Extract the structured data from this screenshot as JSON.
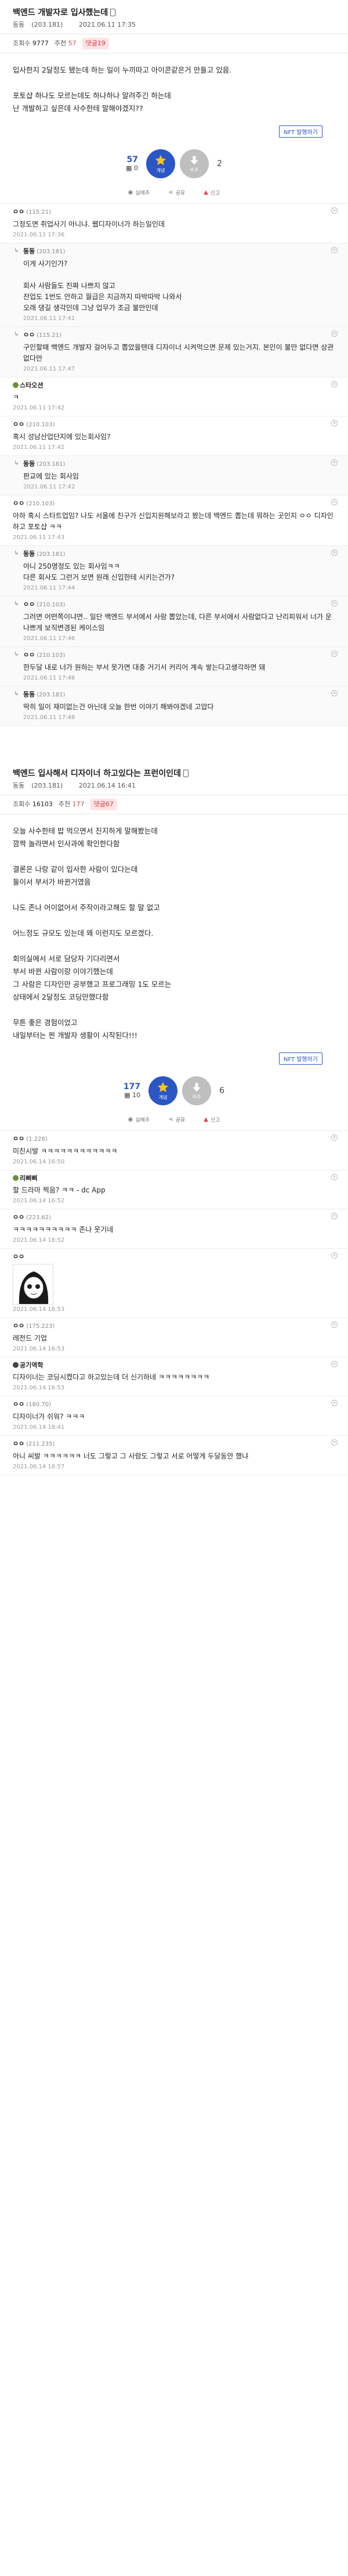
{
  "posts": [
    {
      "title": "백엔드 개발자로 입사했는데",
      "author": "동동",
      "author_ip": "(203.181)",
      "date": "2021.06.11 17:35",
      "views_label": "조회수",
      "views": "9777",
      "recommend_label": "추천",
      "recommend": "57",
      "comments_label": "댓글",
      "comments": "19",
      "body": [
        "입사한지 2달정도 됐는데 하는 일이 누끼따고 아이콘같은거 만들고 있음.",
        "",
        "포토샵 하나도 모르는데도 하나하나 알려주긴 하는데",
        "난 개발하고 싶은데 사수한테 말해야겠지??"
      ],
      "nft_label": "NFT 발행하기",
      "vote_up": "57",
      "vote_fix": "0",
      "vote_up_label": "개념",
      "vote_down_label": "비추",
      "vote_down": "2",
      "actions": [
        "실베추",
        "공유",
        "신고"
      ],
      "comments_list": [
        {
          "reply": false,
          "nick": "ㅇㅇ",
          "ip": "(115.21)",
          "icon": "",
          "text": "그정도면 취업사기 아니냐. 웹디자이너가 하는일인데",
          "date": "2021.06.11 17:36"
        },
        {
          "reply": true,
          "nick": "동동",
          "ip": "(203.181)",
          "icon": "",
          "text": "이게 사기인가?\n\n회사 사람들도 진짜 나쁘지 않고\n잔업도 1번도 안하고 월급은 지금까지 따박따박 나와서\n오래 댕길 생각인데 그냥 업무가 조금 불만인데",
          "date": "2021.06.11 17:41"
        },
        {
          "reply": true,
          "nick": "ㅇㅇ",
          "ip": "(115.21)",
          "icon": "",
          "text": "구인할때 백엔드 개발자 걸어두고 뽑았을텐데 디자이너 시켜먹으면 문제 있는거지. 본인이 불만 없다면 상관없다만",
          "date": "2021.06.11 17:47"
        },
        {
          "reply": false,
          "nick": "스타오션",
          "ip": "",
          "icon": "g",
          "text": "ㅋ",
          "date": "2021.06.11 17:42"
        },
        {
          "reply": false,
          "nick": "ㅇㅇ",
          "ip": "(210.103)",
          "icon": "",
          "text": "혹시 성남산업단지에 있는회사임?",
          "date": "2021.06.11 17:42"
        },
        {
          "reply": true,
          "nick": "동동",
          "ip": "(203.181)",
          "icon": "",
          "text": "판교에 있는 회사임",
          "date": "2021.06.11 17:42"
        },
        {
          "reply": false,
          "nick": "ㅇㅇ",
          "ip": "(210.103)",
          "icon": "",
          "text": "아하 혹시 스타트업임? 나도 서울에 친구가 신입지원해보라고 봤는데 백엔드 뽑는데 뭐하는 곳인지 ㅇㅇ 디자인하고 포토샵 ㅋㅋ",
          "date": "2021.06.11 17:43"
        },
        {
          "reply": true,
          "nick": "동동",
          "ip": "(203.181)",
          "icon": "",
          "text": "아니 250명정도 있는 회사임ㅋㅋ\n다른 회사도 그런거 보면 원래 신입한테 시키는건가?",
          "date": "2021.06.11 17:44"
        },
        {
          "reply": true,
          "nick": "ㅇㅇ",
          "ip": "(210.103)",
          "icon": "",
          "text": "그러면 어떤쪽이냐면.. 일단 백엔드 부서에서 사람 뽑았는데, 다른 부서에서 사람없다고 난리피워서 너가 운나쁘게 보직변경된 케이스임",
          "date": "2021.06.11 17:46"
        },
        {
          "reply": true,
          "nick": "ㅇㅇ",
          "ip": "(210.103)",
          "icon": "",
          "text": "한두달 내로 너가 원하는 부서 못가면 대충 거기서 커리어 계속 쌓는다고생각하면 돼",
          "date": "2021.06.11 17:46"
        },
        {
          "reply": true,
          "nick": "동동",
          "ip": "(203.181)",
          "icon": "",
          "text": "딱히 일이 재미없는건 아닌데 오늘 한번 이야기 해봐야겠네 고맙다",
          "date": "2021.06.11 17:48"
        }
      ]
    },
    {
      "title": "백엔드 입사해서 디자이너 하고있다는 프런이인데",
      "author": "동동",
      "author_ip": "(203.181)",
      "date": "2021.06.14 16:41",
      "views_label": "조회수",
      "views": "16103",
      "recommend_label": "추천",
      "recommend": "177",
      "comments_label": "댓글",
      "comments": "67",
      "body": [
        "오늘 사수한테 밥 먹으면서 진지하게 말해봤는데",
        "깜짝 놀라면서 인사과에 확인한다함",
        "",
        "결론은 나랑 같이 입사한 사람이 있다는데",
        "둘이서 부서가 바뀐거였음",
        "",
        "나도 존나 어이없어서 주작이라고해도 할 말 없고",
        "",
        "어느정도 규모도 있는데 왜 이런지도 모르겠다.",
        "",
        "회의실에서 서로 담당자 기다리면서",
        "부서 바뀐 사람이랑 이야기했는데",
        "그 사람은 디자인만 공부했고 프로그래밍 1도 모르는",
        "상태에서 2달정도 코딩만했다함",
        "",
        "무튼 좋은 경험이었고",
        "내일부터는 찐 개발자 생활이 시작된다!!!"
      ],
      "nft_label": "NFT 발행하기",
      "vote_up": "177",
      "vote_fix": "10",
      "vote_up_label": "개념",
      "vote_down_label": "비추",
      "vote_down": "6",
      "actions": [
        "실베추",
        "공유",
        "신고"
      ],
      "comments_list": [
        {
          "reply": false,
          "nick": "ㅇㅇ",
          "ip": "(1.228)",
          "icon": "",
          "text": "미친시발 ㅋㅋㅋㅋㅋㅋㅋㅋㅋㅋㅋㅋ",
          "date": "2021.06.14 16:50"
        },
        {
          "reply": false,
          "nick": "리삐삐",
          "ip": "",
          "icon": "g",
          "text": "할 드라마 찍음? ㅋㅋ - dc App",
          "date": "2021.06.14 16:52"
        },
        {
          "reply": false,
          "nick": "ㅇㅇ",
          "ip": "(223.62)",
          "icon": "",
          "text": "ㅋㅋㅋㅋㅋㅋㅋㅋㅋㅋ 존나 웃기네",
          "date": "2021.06.14 16:52"
        },
        {
          "reply": false,
          "nick": "ㅇㅇ",
          "ip": "",
          "icon": "",
          "text": "",
          "dccon": true,
          "date": "2021.06.14 16:53"
        },
        {
          "reply": false,
          "nick": "ㅇㅇ",
          "ip": "(175.223)",
          "icon": "",
          "text": "레전드 기업",
          "date": "2021.06.14 16:53"
        },
        {
          "reply": false,
          "nick": "공기역학",
          "ip": "",
          "icon": "b",
          "text": "디자이너는 코딩시켰다고 하고있는데 더 신기하네 ㅋㅋㅋㅋㅋㅋㅋㅋ",
          "date": "2021.06.14 16:53"
        },
        {
          "reply": false,
          "nick": "ㅇㅇ",
          "ip": "(180.70)",
          "icon": "",
          "text": "디자이너가 쉬워? ㅋㅋㅋ",
          "date": "2021.06.14 18:41"
        },
        {
          "reply": false,
          "nick": "ㅇㅇ",
          "ip": "(211.235)",
          "icon": "",
          "text": "아니 씨발 ㅋㅋㅋㅋㅋㅋ 너도 그렇고 그 사람도 그렇고 서로 어떻게 두달동안 했냐",
          "date": "2021.06.14 18:57"
        }
      ]
    }
  ]
}
